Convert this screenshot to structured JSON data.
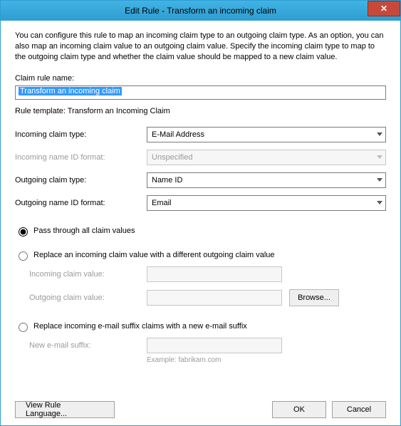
{
  "window": {
    "title": "Edit Rule - Transform an incoming claim"
  },
  "intro": "You can configure this rule to map an incoming claim type to an outgoing claim type. As an option, you can also map an incoming claim value to an outgoing claim value. Specify the incoming claim type to map to the outgoing claim type and whether the claim value should be mapped to a new claim value.",
  "labels": {
    "claim_rule_name": "Claim rule name:",
    "rule_template": "Rule template: Transform an Incoming Claim",
    "incoming_type": "Incoming claim type:",
    "incoming_nameid": "Incoming name ID format:",
    "outgoing_type": "Outgoing claim type:",
    "outgoing_nameid": "Outgoing name ID format:",
    "radio_passthrough": "Pass through all claim values",
    "radio_replace_value": "Replace an incoming claim value with a different outgoing claim value",
    "incoming_value": "Incoming claim value:",
    "outgoing_value": "Outgoing claim value:",
    "browse": "Browse...",
    "radio_replace_suffix": "Replace incoming e-mail suffix claims with a new e-mail suffix",
    "new_suffix": "New e-mail suffix:",
    "example": "Example: fabrikam.com",
    "view_lang": "View Rule Language...",
    "ok": "OK",
    "cancel": "Cancel"
  },
  "values": {
    "rule_name": "Transform an incoming claim",
    "incoming_type": "E-Mail Address",
    "incoming_nameid": "Unspecified",
    "outgoing_type": "Name ID",
    "outgoing_nameid": "Email"
  }
}
